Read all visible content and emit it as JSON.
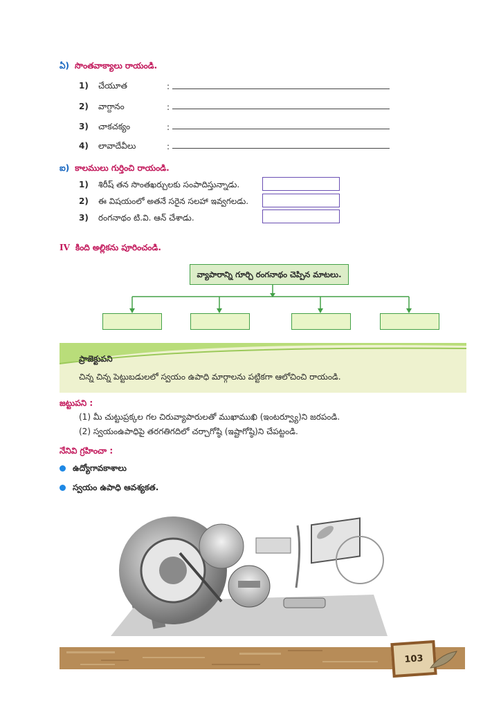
{
  "section_e": {
    "marker": "ఏ)",
    "title": "సొంతవాక్యాలు రాయండి.",
    "items": [
      {
        "num": "1)",
        "word": "చేయూత",
        "sep": ":"
      },
      {
        "num": "2)",
        "word": "వాగ్దానం",
        "sep": ":"
      },
      {
        "num": "3)",
        "word": "చాకచక్యం",
        "sep": ":"
      },
      {
        "num": "4)",
        "word": "లావాదేవీలు",
        "sep": ":"
      }
    ]
  },
  "section_ai": {
    "marker": "ఐ)",
    "title": "కాలములు గుర్తించి రాయండి.",
    "items": [
      {
        "num": "1)",
        "text": "శిరీష్ తన సొంతఖర్చులకు సంపాదిస్తున్నాడు."
      },
      {
        "num": "2)",
        "text": "ఈ విషయంలో అతనే సరైన సలహా ఇవ్వగలడు."
      },
      {
        "num": "3)",
        "text": "రంగనాథం టి.వి. ఆన్ చేశాడు."
      }
    ]
  },
  "section_iv": {
    "marker": "IV",
    "title": "కింది అల్లికను పూరించండి.",
    "root_box": "వ్యాపారాన్ని గూర్చి రంగనాథం చెప్పిన మాటలు."
  },
  "project": {
    "title": "ప్రాజెక్టుపని",
    "text": "చిన్న చిన్న పెట్టుబడులలో స్వయం ఉపాధి మార్గాలను పట్టికగా ఆలోచించి రాయండి."
  },
  "group_work": {
    "title": "జట్టుపని :",
    "items": [
      "(1) మీ చుట్టుప్రక్కల గల చిరువ్యాపారులతో ముఖాముఖి (ఇంటర్వ్యూ)ని జరపండి.",
      "(2) స్వయంఉపాధిపై తరగతిగదిలో చర్చాగోష్ఠి (ఇష్టాగోష్ఠి)ని చేపట్టండి."
    ]
  },
  "learned": {
    "title": "నేనివి గ్రహించా :",
    "items": [
      "ఉద్యోగావకాశాలు",
      "స్వయం ఉపాధి ఆవశ్యకత."
    ]
  },
  "page_number": "103",
  "colors": {
    "heading": "#c2185b",
    "marker": "#1565c0",
    "tree": "#43a047",
    "box": "#6a4fb3"
  }
}
